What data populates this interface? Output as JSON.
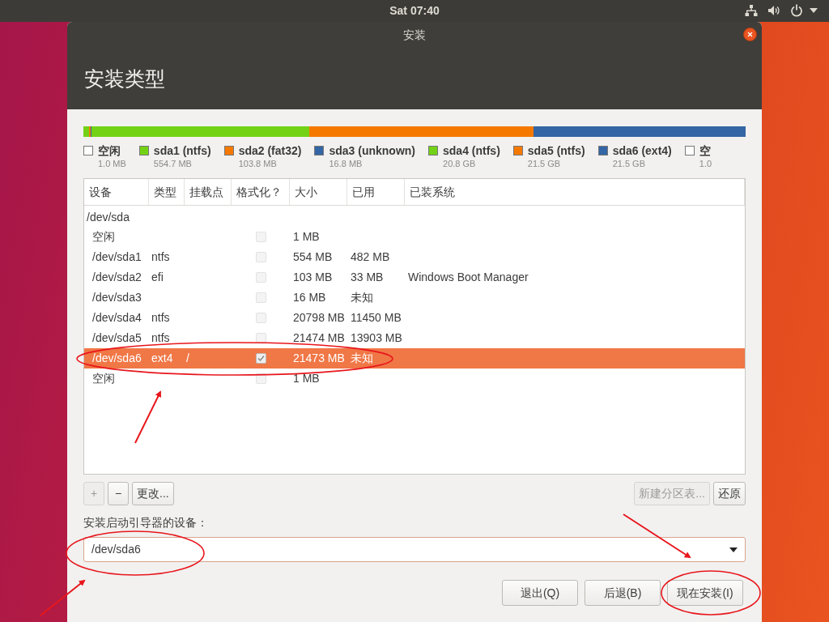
{
  "top_bar": {
    "clock": "Sat 07:40"
  },
  "window": {
    "title": "安装",
    "heading": "安装类型"
  },
  "partition_bar": [
    {
      "color": "#73d216"
    },
    {
      "color": "#f57900"
    },
    {
      "color": "#3465a4"
    },
    {
      "color": "#73d216"
    },
    {
      "color": "#f57900"
    },
    {
      "color": "#3465a4"
    }
  ],
  "legend": [
    {
      "label": "空闲",
      "size": "1.0 MB",
      "color": "#ffffff"
    },
    {
      "label": "sda1 (ntfs)",
      "size": "554.7 MB",
      "color": "#73d216"
    },
    {
      "label": "sda2 (fat32)",
      "size": "103.8 MB",
      "color": "#f57900"
    },
    {
      "label": "sda3 (unknown)",
      "size": "16.8 MB",
      "color": "#3465a4"
    },
    {
      "label": "sda4 (ntfs)",
      "size": "20.8 GB",
      "color": "#73d216"
    },
    {
      "label": "sda5 (ntfs)",
      "size": "21.5 GB",
      "color": "#f57900"
    },
    {
      "label": "sda6 (ext4)",
      "size": "21.5 GB",
      "color": "#3465a4"
    },
    {
      "label": "空",
      "size": "1.0",
      "color": "#ffffff"
    }
  ],
  "table": {
    "columns": [
      "设备",
      "类型",
      "挂载点",
      "格式化？",
      "大小",
      "已用",
      "已装系统"
    ],
    "rows": [
      {
        "kind": "disk",
        "device": "/dev/sda"
      },
      {
        "kind": "partition",
        "device": "空闲",
        "type": "",
        "mount": "",
        "format": false,
        "size": "1 MB",
        "used": "",
        "system": "",
        "selected": false
      },
      {
        "kind": "partition",
        "device": "/dev/sda1",
        "type": "ntfs",
        "mount": "",
        "format": false,
        "size": "554 MB",
        "used": "482 MB",
        "system": "",
        "selected": false
      },
      {
        "kind": "partition",
        "device": "/dev/sda2",
        "type": "efi",
        "mount": "",
        "format": false,
        "size": "103 MB",
        "used": "33 MB",
        "system": "Windows Boot Manager",
        "selected": false
      },
      {
        "kind": "partition",
        "device": "/dev/sda3",
        "type": "",
        "mount": "",
        "format": false,
        "size": "16 MB",
        "used": "未知",
        "system": "",
        "selected": false
      },
      {
        "kind": "partition",
        "device": "/dev/sda4",
        "type": "ntfs",
        "mount": "",
        "format": false,
        "size": "20798 MB",
        "used": "11450 MB",
        "system": "",
        "selected": false
      },
      {
        "kind": "partition",
        "device": "/dev/sda5",
        "type": "ntfs",
        "mount": "",
        "format": false,
        "size": "21474 MB",
        "used": "13903 MB",
        "system": "",
        "selected": false
      },
      {
        "kind": "partition",
        "device": "/dev/sda6",
        "type": "ext4",
        "mount": "/",
        "format": true,
        "size": "21473 MB",
        "used": "未知",
        "system": "",
        "selected": true
      },
      {
        "kind": "partition",
        "device": "空闲",
        "type": "",
        "mount": "",
        "format": false,
        "size": "1 MB",
        "used": "",
        "system": "",
        "selected": false
      }
    ]
  },
  "table_buttons": [
    {
      "label": "+",
      "disabled": true
    },
    {
      "label": "−",
      "disabled": false
    },
    {
      "label": "更改...",
      "disabled": false
    }
  ],
  "right_buttons": [
    {
      "label": "新建分区表...",
      "disabled": true
    },
    {
      "label": "还原",
      "disabled": false
    }
  ],
  "bootloader": {
    "label": "安装启动引导器的设备：",
    "value": "/dev/sda6"
  },
  "footer_buttons": [
    {
      "label": "退出(Q)"
    },
    {
      "label": "后退(B)"
    },
    {
      "label": "现在安装(I)"
    }
  ]
}
